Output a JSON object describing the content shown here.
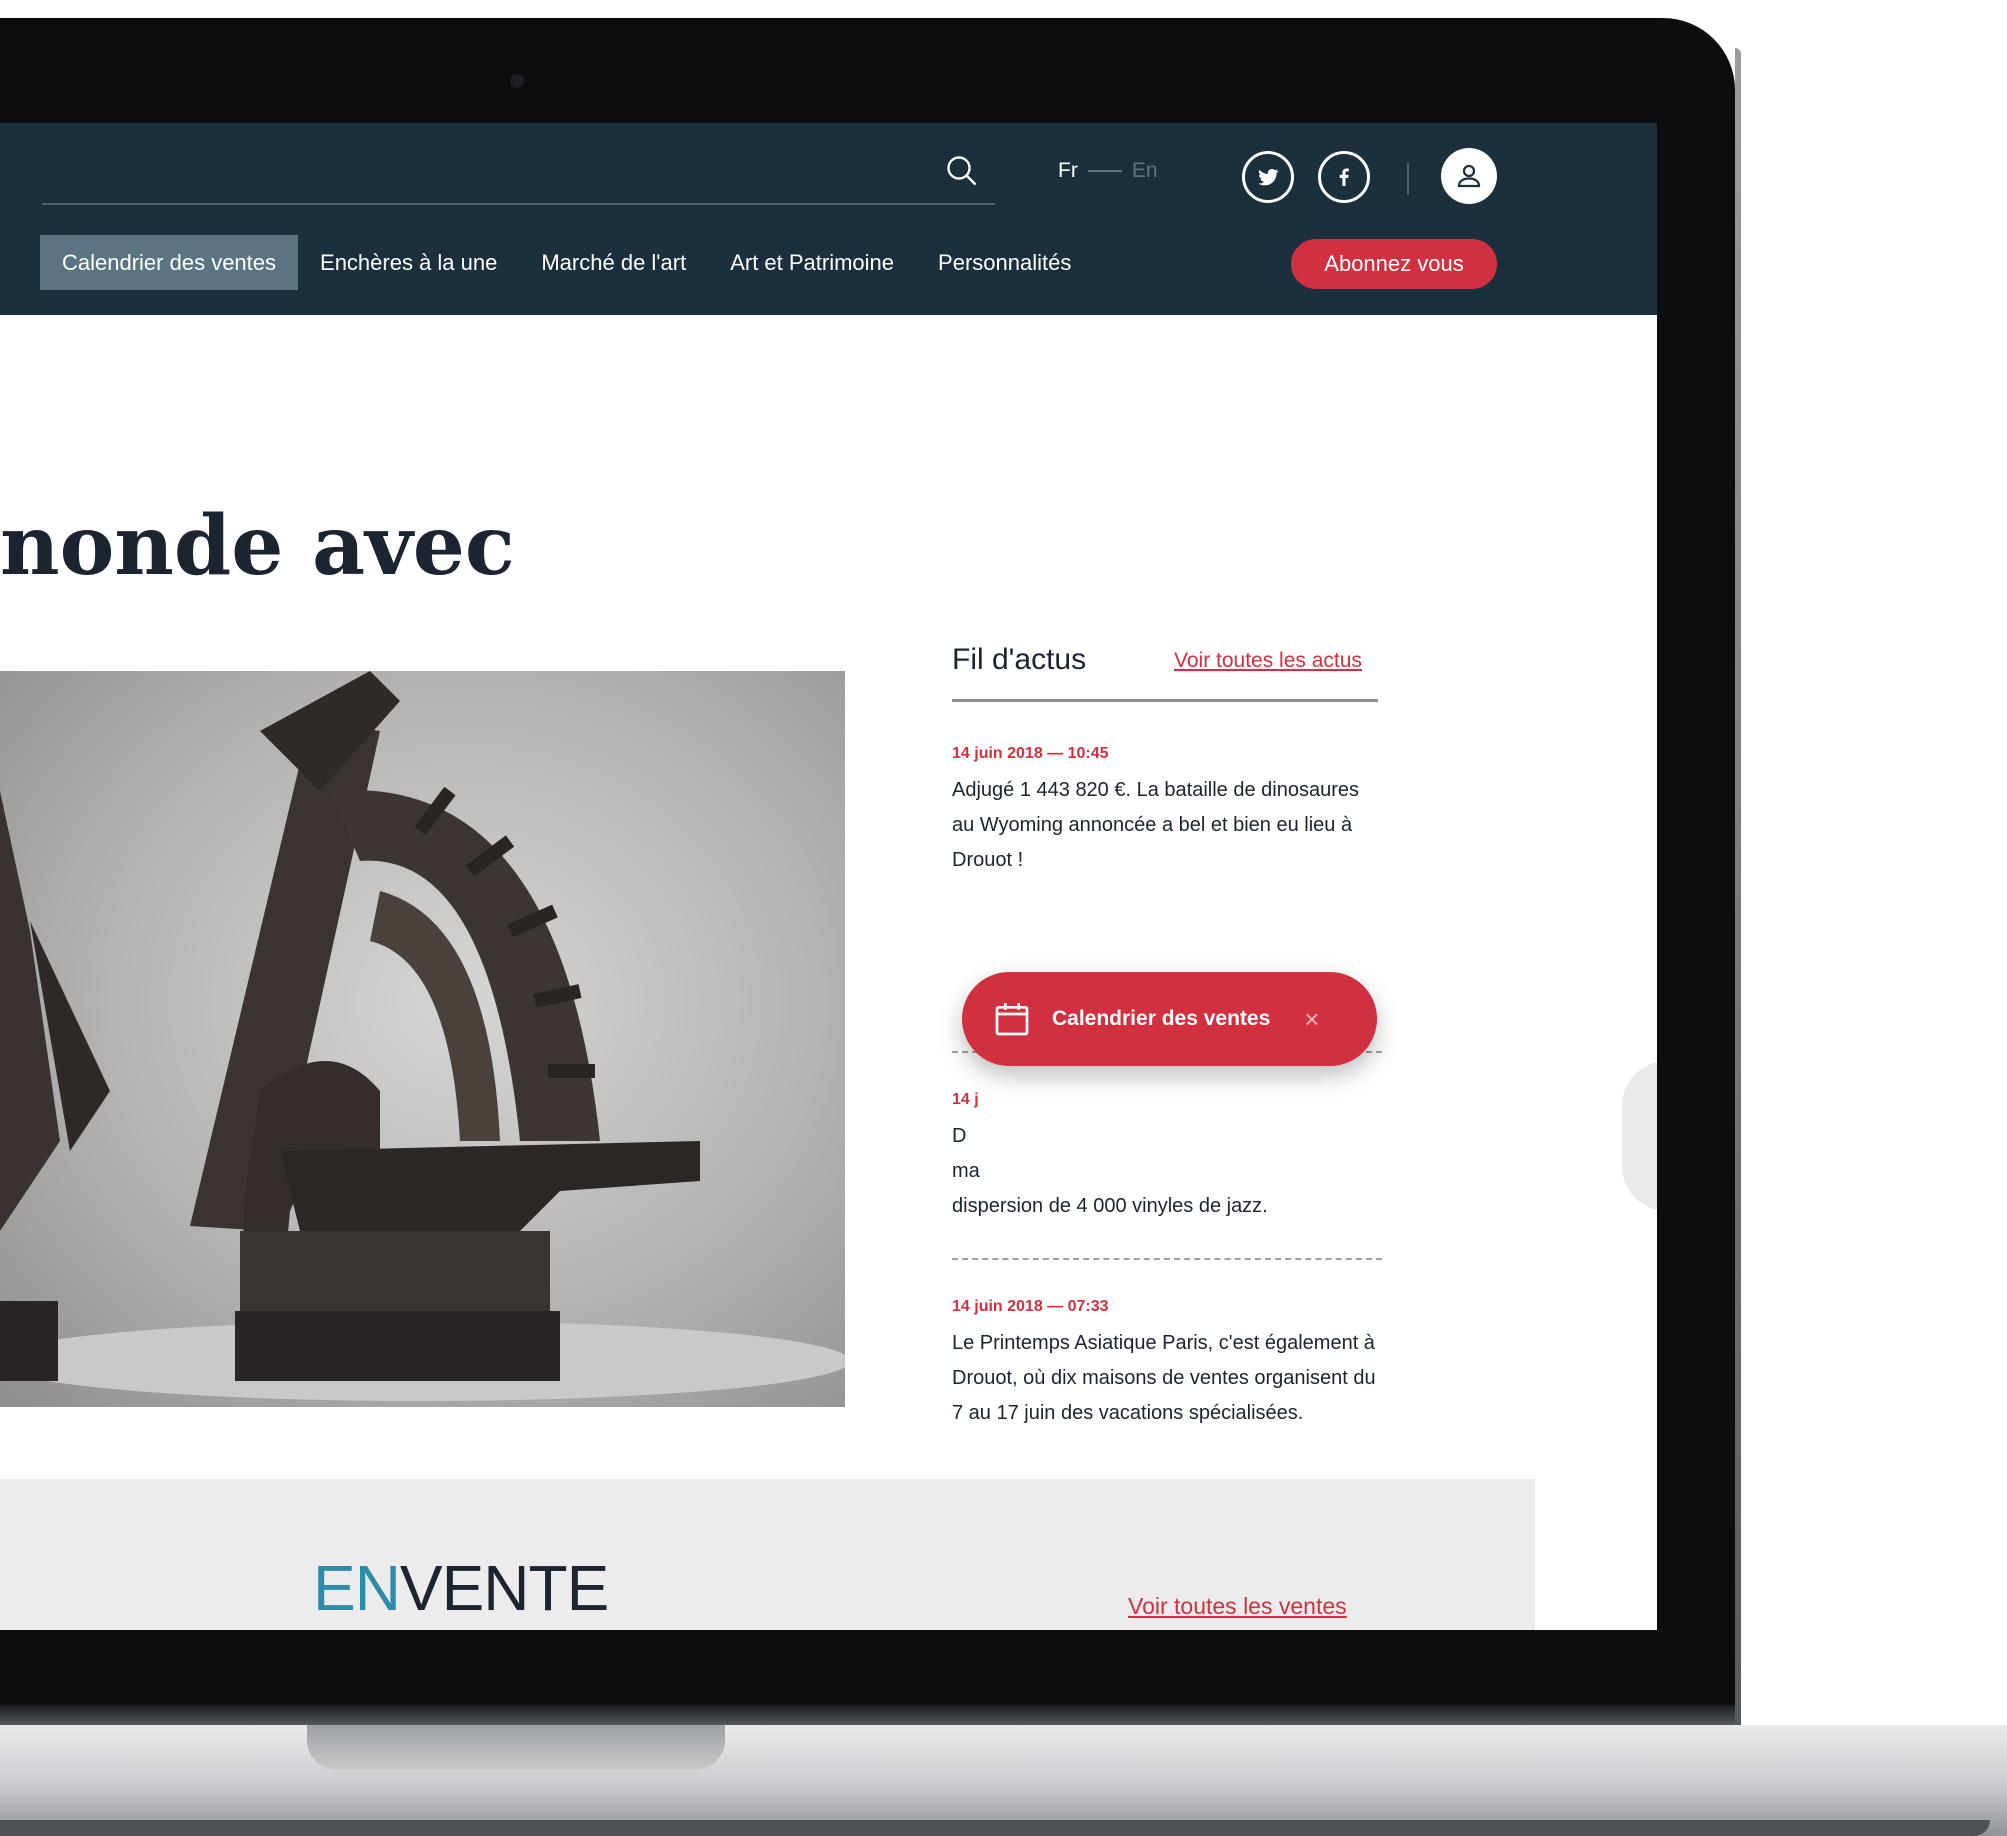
{
  "header": {
    "language": {
      "active": "Fr",
      "inactive": "En"
    },
    "nav": [
      {
        "label": "Calendrier des ventes",
        "active": true
      },
      {
        "label": "Enchères à la une",
        "active": false
      },
      {
        "label": "Marché de l'art",
        "active": false
      },
      {
        "label": "Art et Patrimoine",
        "active": false
      },
      {
        "label": "Personnalités",
        "active": false
      }
    ],
    "subscribe_label": "Abonnez vous"
  },
  "headline": "nonde avec",
  "news_feed": {
    "title": "Fil d'actus",
    "see_all_label": "Voir toutes les actus",
    "items": [
      {
        "date": "14 juin 2018 — 10:45",
        "text": "Adjugé 1 443 820 €. La bataille de dinosaures au Wyoming annoncée a bel et bien eu lieu à Drouot !"
      },
      {
        "date": "14 j",
        "text_partial_1": "D",
        "text_partial_2": "ma",
        "text": "dispersion de 4 000 vinyles de jazz."
      },
      {
        "date": "14 juin 2018 — 07:33",
        "text": "Le Printemps Asiatique Paris, c'est également à Drouot,  où dix maisons de ventes organisent du 7 au 17 juin des vacations spécialisées."
      }
    ]
  },
  "toast": {
    "label": "Calendrier des ventes",
    "close_symbol": "×"
  },
  "sale_section": {
    "title_en": "EN",
    "title_rest": "VENTE",
    "see_all_label": "Voir toutes les ventes"
  },
  "colors": {
    "header_bg": "#1b2f3d",
    "accent": "#d0303f",
    "nav_active": "#5b7482",
    "envente_blue": "#2d8ca8"
  },
  "icons": [
    "search-icon",
    "twitter-icon",
    "facebook-icon",
    "user-icon",
    "calendar-icon",
    "close-icon"
  ]
}
